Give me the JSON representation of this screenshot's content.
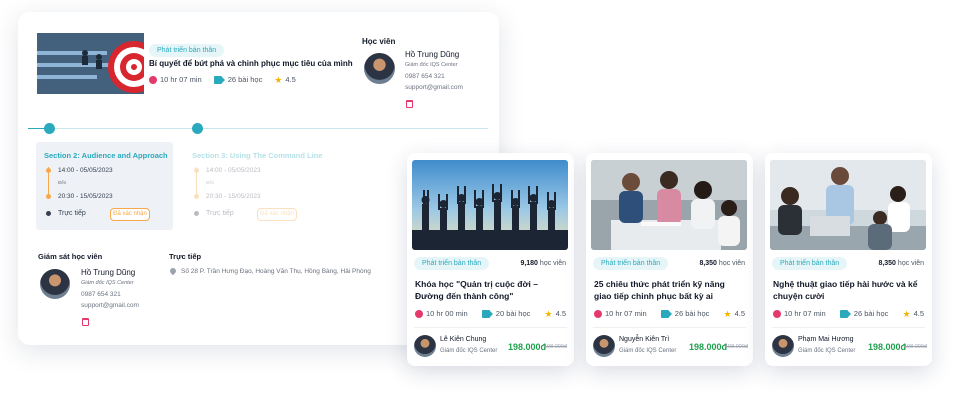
{
  "course_header": {
    "category": "Phát triển bản thân",
    "title": "Bí quyết để bứt phá và chinh phục mục tiêu của mình",
    "duration": "10 hr 07 min",
    "lessons": "26 bài học",
    "rating": "4.5"
  },
  "student": {
    "heading": "Học viên",
    "name": "Hồ Trung Dũng",
    "role": "Giám đốc IQS Center",
    "phone": "0987 654 321",
    "email": "support@gmail.com"
  },
  "sections": [
    {
      "title": "Section 2: Audience and Approach",
      "time1": "14:00 - 05/05/2023",
      "sep": "Đến",
      "time2": "20:30 - 15/05/2023",
      "mode": "Trực tiếp",
      "button": "Đã xác nhận"
    },
    {
      "title": "Section 3: Using The Command Line",
      "time1": "14:00 - 05/05/2023",
      "sep": "Đến",
      "time2": "20:30 - 15/05/2023",
      "mode": "Trực tiếp",
      "button": "Đã xác nhận"
    }
  ],
  "supervisor": {
    "heading": "Giám sát học viên",
    "name": "Hồ Trung Dũng",
    "role": "Giám đốc IQS Center",
    "phone": "0987 654 321",
    "email": "support@gmail.com"
  },
  "location": {
    "heading": "Trực tiếp",
    "address": "Số 28 P. Trần Hưng Đạo, Hoàng Văn Thụ, Hồng Bàng, Hải Phòng"
  },
  "cards": [
    {
      "category": "Phát triển bản thân",
      "learners_num": "9,180",
      "learners_unit": "học viên",
      "title": "Khóa học \"Quản trị cuộc đời – Đường đến thành công\"",
      "duration": "10 hr 00 min",
      "lessons": "20 bài học",
      "rating": "4.5",
      "instructor": "Lê Kiên Chung",
      "role": "Giám đốc IQS Center",
      "price": "198.000đ",
      "old_price": "198.000đ"
    },
    {
      "category": "Phát triển bản thân",
      "learners_num": "8,350",
      "learners_unit": "học viên",
      "title": "25 chiêu thức phát triển kỹ năng giao tiếp chinh phục bất kỳ ai",
      "duration": "10 hr 07 min",
      "lessons": "26 bài học",
      "rating": "4.5",
      "instructor": "Nguyễn Kiên Trì",
      "role": "Giám đốc IQS Center",
      "price": "198.000đ",
      "old_price": "198.000đ"
    },
    {
      "category": "Phát triển bản thân",
      "learners_num": "8,350",
      "learners_unit": "học viên",
      "title": "Nghệ thuật giao tiếp hài hước và kể chuyện cười",
      "duration": "10 hr 07 min",
      "lessons": "26 bài học",
      "rating": "4.5",
      "instructor": "Phạm Mai Hương",
      "role": "Giám đốc IQS Center",
      "price": "198.000đ",
      "old_price": "198.000đ"
    }
  ],
  "colors": {
    "accent": "#2aa9bd",
    "pink": "#e5386b",
    "green": "#1fa04e",
    "orange": "#f6a84a",
    "star": "#f5b400"
  }
}
